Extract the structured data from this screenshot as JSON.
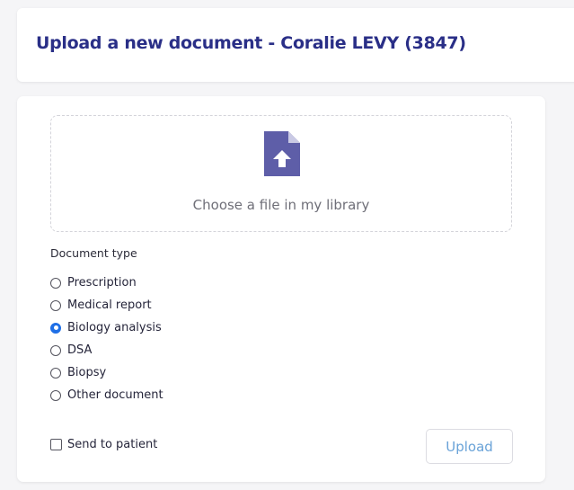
{
  "header": {
    "title": "Upload a new document - Coralie LEVY (3847)"
  },
  "dropzone": {
    "icon": "file-upload-icon",
    "label": "Choose a file in my library"
  },
  "document_type": {
    "label": "Document type",
    "options": [
      {
        "label": "Prescription",
        "checked": false
      },
      {
        "label": "Medical report",
        "checked": false
      },
      {
        "label": "Biology analysis",
        "checked": true
      },
      {
        "label": "DSA",
        "checked": false
      },
      {
        "label": "Biopsy",
        "checked": false
      },
      {
        "label": "Other document",
        "checked": false
      }
    ],
    "selected": "Biology analysis"
  },
  "send_to_patient": {
    "label": "Send to patient",
    "checked": false
  },
  "upload_button": {
    "label": "Upload"
  },
  "colors": {
    "title": "#2a2f87",
    "icon": "#5e5ea8",
    "radio_selected": "#1f6fe6",
    "upload_text": "#6aa3d8"
  }
}
